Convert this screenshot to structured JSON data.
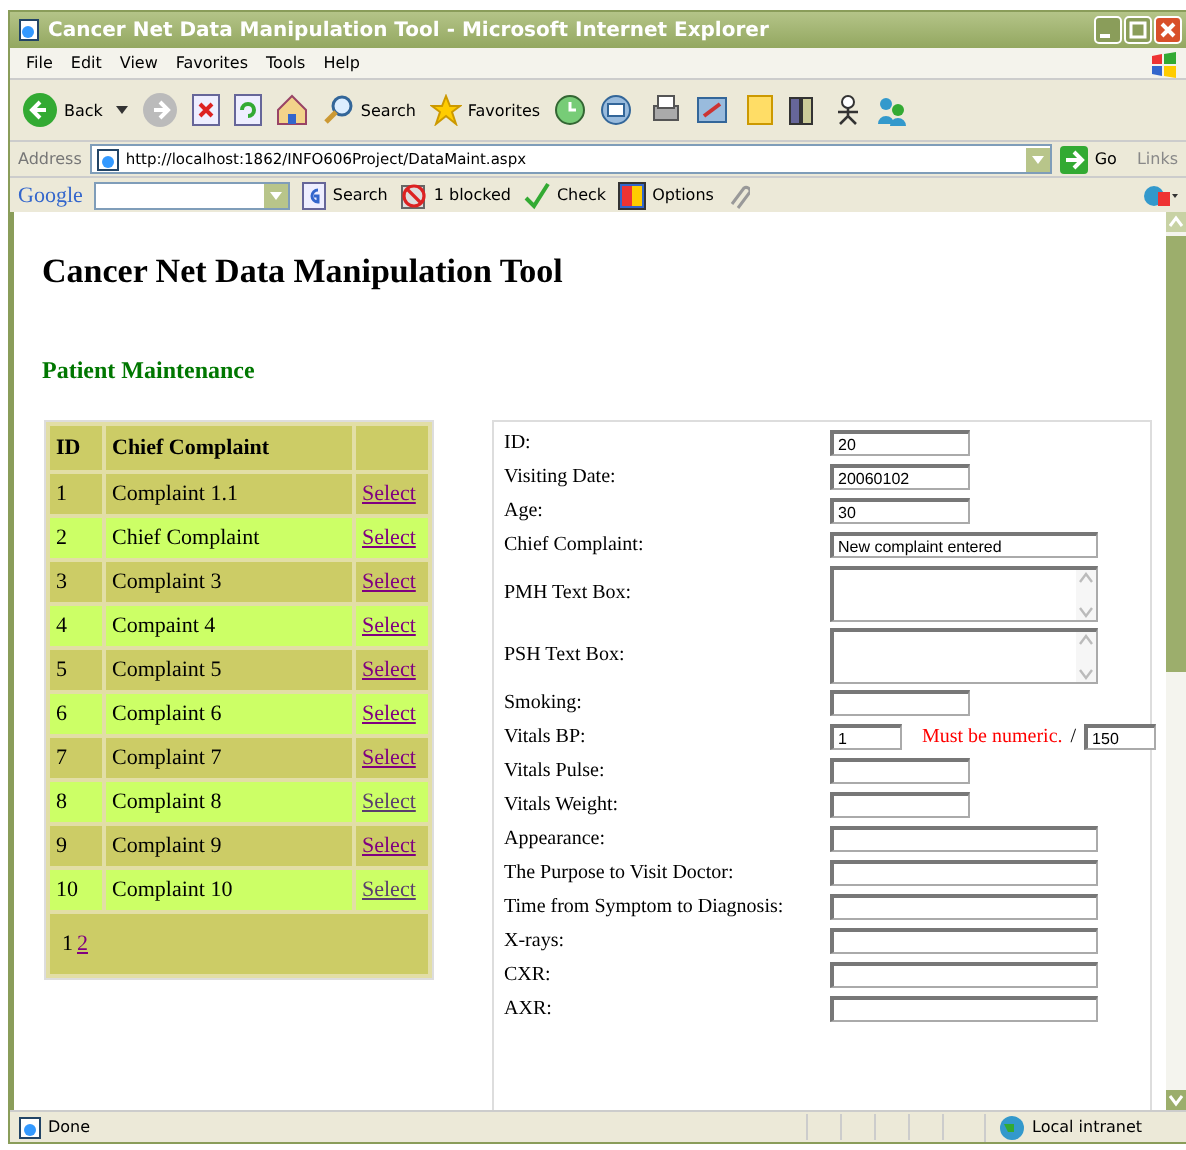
{
  "window": {
    "title": "Cancer Net Data Manipulation Tool - Microsoft Internet Explorer"
  },
  "menu": [
    "File",
    "Edit",
    "View",
    "Favorites",
    "Tools",
    "Help"
  ],
  "toolbar": {
    "back": "Back",
    "search": "Search",
    "favorites": "Favorites"
  },
  "address": {
    "label": "Address",
    "url": "http://localhost:1862/INFO606Project/DataMaint.aspx",
    "go": "Go",
    "links": "Links"
  },
  "google_bar": {
    "logo": "Google",
    "search": "Search",
    "blocked": "1 blocked",
    "check": "Check",
    "options": "Options"
  },
  "page": {
    "heading": "Cancer Net Data Manipulation Tool",
    "subheading": "Patient Maintenance"
  },
  "table": {
    "columns": [
      "ID",
      "Chief Complaint"
    ],
    "rows": [
      {
        "id": "1",
        "complaint": "Complaint 1.1",
        "link": "Select",
        "visited": true
      },
      {
        "id": "2",
        "complaint": "Chief Complaint",
        "link": "Select",
        "visited": true
      },
      {
        "id": "3",
        "complaint": "Complaint 3",
        "link": "Select",
        "visited": true
      },
      {
        "id": "4",
        "complaint": "Compaint 4",
        "link": "Select",
        "visited": true
      },
      {
        "id": "5",
        "complaint": "Complaint 5",
        "link": "Select",
        "visited": true
      },
      {
        "id": "6",
        "complaint": "Complaint 6",
        "link": "Select",
        "visited": true
      },
      {
        "id": "7",
        "complaint": "Complaint 7",
        "link": "Select",
        "visited": true
      },
      {
        "id": "8",
        "complaint": "Complaint 8",
        "link": "Select",
        "visited": false
      },
      {
        "id": "9",
        "complaint": "Complaint 9",
        "link": "Select",
        "visited": true
      },
      {
        "id": "10",
        "complaint": "Complaint 10",
        "link": "Select",
        "visited": false
      }
    ],
    "pages": [
      {
        "label": "1",
        "selected": true
      },
      {
        "label": "2",
        "selected": false
      }
    ]
  },
  "form": [
    {
      "label": "ID:",
      "kind": "short",
      "value": "20"
    },
    {
      "label": "Visiting Date:",
      "kind": "short",
      "value": "20060102"
    },
    {
      "label": "Age:",
      "kind": "short",
      "value": "30"
    },
    {
      "label": "Chief Complaint:",
      "kind": "long",
      "value": "New complaint entered"
    },
    {
      "label": "PMH Text Box:",
      "kind": "area"
    },
    {
      "label": "PSH Text Box:",
      "kind": "area"
    },
    {
      "label": "Smoking:",
      "kind": "short"
    },
    {
      "label": "Vitals BP:",
      "kind": "bp",
      "value": "1",
      "error": "Must be numeric.",
      "separator": "/",
      "value2": "150"
    },
    {
      "label": "Vitals Pulse:",
      "kind": "short"
    },
    {
      "label": "Vitals Weight:",
      "kind": "short"
    },
    {
      "label": "Appearance:",
      "kind": "long"
    },
    {
      "label": "The Purpose to Visit Doctor:",
      "kind": "long"
    },
    {
      "label": "Time from Symptom to Diagnosis:",
      "kind": "long"
    },
    {
      "label": "X-rays:",
      "kind": "long"
    },
    {
      "label": "CXR:",
      "kind": "long"
    },
    {
      "label": "AXR:",
      "kind": "long"
    }
  ],
  "status_bar": {
    "text": "Done",
    "zone": "Local intranet"
  }
}
